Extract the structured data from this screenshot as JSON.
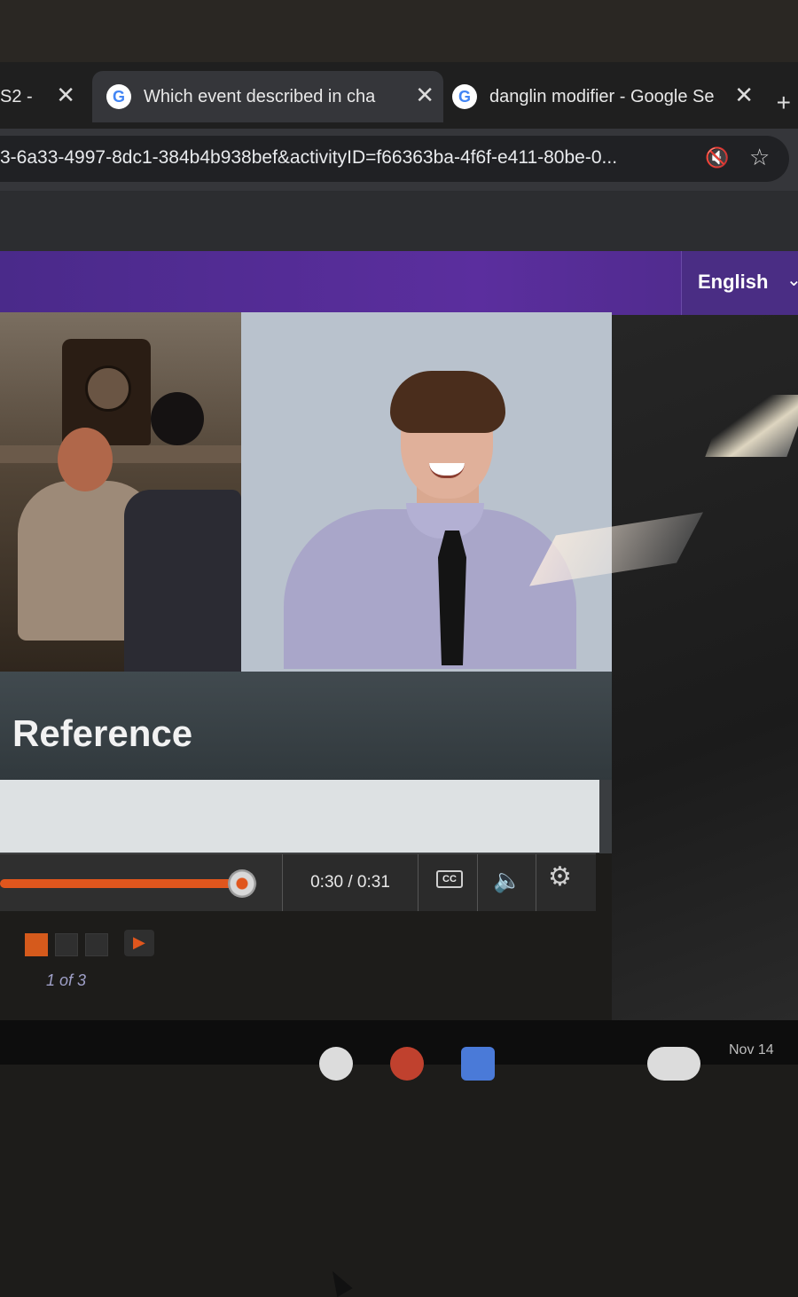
{
  "browser": {
    "tabs": [
      {
        "label": "S2 -",
        "active": false
      },
      {
        "label": "Which event described in cha",
        "active": true
      },
      {
        "label": "danglin modifier - Google Se",
        "active": false
      }
    ],
    "tab_close_glyph": "✕",
    "new_tab_glyph": "+",
    "url": "3-6a33-4997-8dc1-384b4b938bef&activityID=f66363ba-4f6f-e411-80be-0...",
    "mute_icon": "muted-speaker-icon",
    "star_icon": "star-icon"
  },
  "header": {
    "language": "English",
    "brand_color": "#5b2e9e"
  },
  "video": {
    "title": "Reference",
    "progress_fraction": 0.97,
    "time_display": "0:30 / 0:31",
    "cc_label": "CC",
    "accent_color": "#e0561d"
  },
  "pager": {
    "label": "1 of 3",
    "next_glyph": "▶"
  },
  "shelf": {
    "date": "Nov 14"
  }
}
